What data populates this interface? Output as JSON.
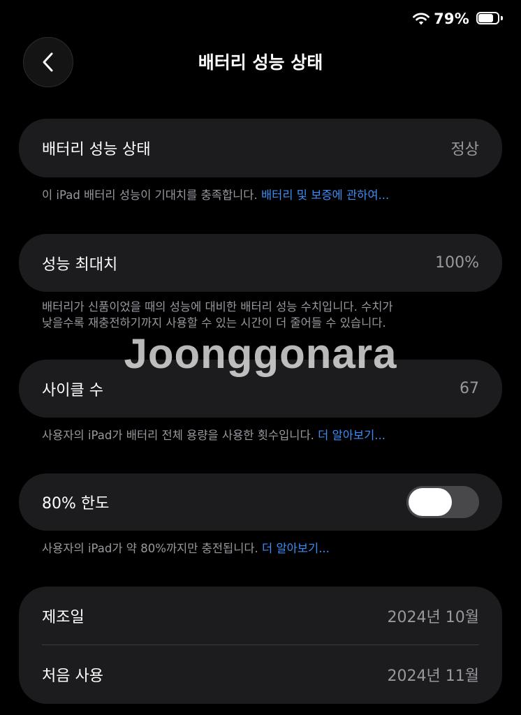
{
  "status_bar": {
    "battery_percent": "79%",
    "battery_level": 0.79,
    "wifi_icon": "wifi-icon",
    "battery_icon": "battery-icon"
  },
  "nav": {
    "back_icon": "chevron-left-icon",
    "title": "배터리 성능 상태"
  },
  "sections": {
    "battery_health": {
      "label": "배터리 성능 상태",
      "value": "정상",
      "footnote": "이 iPad 배터리 성능이 기대치를 충족합니다. ",
      "footnote_link": "배터리 및 보증에 관하여..."
    },
    "max_capacity": {
      "label": "성능 최대치",
      "value": "100%",
      "footnote_line1": "배터리가 신품이었을 때의 성능에 대비한 배터리 성능 수치입니다. 수치가",
      "footnote_line2": "낮을수록 재충전하기까지 사용할 수 있는 시간이 더 줄어들 수 있습니다."
    },
    "cycle_count": {
      "label": "사이클 수",
      "value": "67",
      "footnote": "사용자의 iPad가 배터리 전체 용량을 사용한 횟수입니다. ",
      "footnote_link": "더 알아보기..."
    },
    "limit_80": {
      "label": "80% 한도",
      "toggle_on": false,
      "footnote": "사용자의 iPad가 약 80%까지만 충전됩니다. ",
      "footnote_link": "더 알아보기..."
    },
    "dates": {
      "manufacture_label": "제조일",
      "manufacture_value": "2024년 10월",
      "first_use_label": "처음 사용",
      "first_use_value": "2024년 11월"
    }
  },
  "watermark": "Joonggonara",
  "colors": {
    "background": "#000000",
    "card": "#1c1c1e",
    "secondary_text": "#98989f",
    "link": "#3b8ef7",
    "toggle_track_off": "#48484a"
  }
}
